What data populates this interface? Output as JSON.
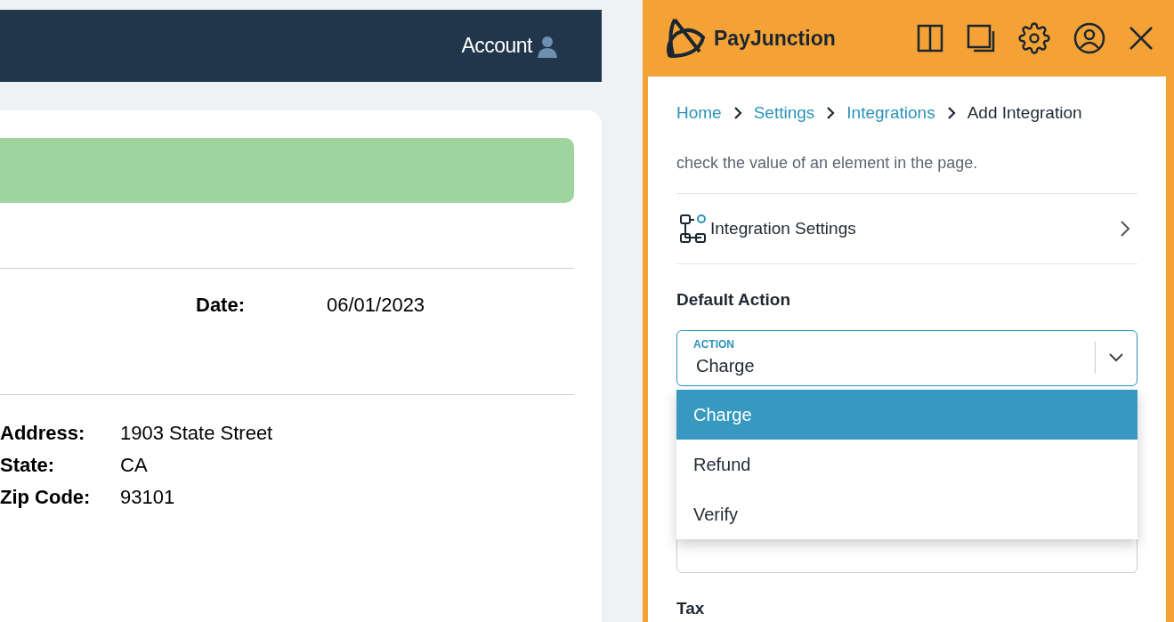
{
  "page": {
    "nav": {
      "account": "Account"
    },
    "details": {
      "date_label": "Date:",
      "date_value": "06/01/2023",
      "address_rows": [
        {
          "label": "Address:",
          "value": "1903 State Street"
        },
        {
          "label": "State:",
          "value": "CA"
        },
        {
          "label": "Zip Code:",
          "value": "93101"
        }
      ]
    }
  },
  "panel": {
    "brand": "PayJunction",
    "breadcrumb": [
      {
        "label": "Home",
        "current": false
      },
      {
        "label": "Settings",
        "current": false
      },
      {
        "label": "Integrations",
        "current": false
      },
      {
        "label": "Add Integration",
        "current": true
      }
    ],
    "description": "check the value of an element in the page.",
    "settings_row": {
      "label": "Integration Settings"
    },
    "default_action": {
      "heading": "Default Action",
      "select": {
        "label": "ACTION",
        "value": "Charge",
        "expanded": true
      },
      "options": [
        {
          "label": "Charge",
          "selected": true
        },
        {
          "label": "Refund",
          "selected": false
        },
        {
          "label": "Verify",
          "selected": false
        }
      ]
    },
    "tax": {
      "heading": "Tax"
    }
  }
}
